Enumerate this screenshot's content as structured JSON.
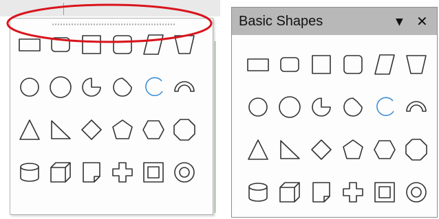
{
  "colors": {
    "annotation": "#d9141c",
    "title_bar": "#b8b8b8",
    "icon_stroke": "#333333",
    "accent_arc": "#3d8fd6"
  },
  "right_panel": {
    "title": "Basic Shapes",
    "dropdown_icon": "▼",
    "close_icon": "✕"
  },
  "shapes": [
    "rectangle",
    "rounded-rectangle",
    "square",
    "rounded-square",
    "parallelogram",
    "trapezoid",
    "circle",
    "ellipse",
    "circle-pie",
    "block-arc-circle",
    "arc",
    "block-arc",
    "isosceles-triangle",
    "right-triangle",
    "diamond",
    "pentagon",
    "hexagon",
    "octagon",
    "cylinder",
    "cube",
    "folded-corner",
    "cross",
    "frame",
    "ring"
  ]
}
